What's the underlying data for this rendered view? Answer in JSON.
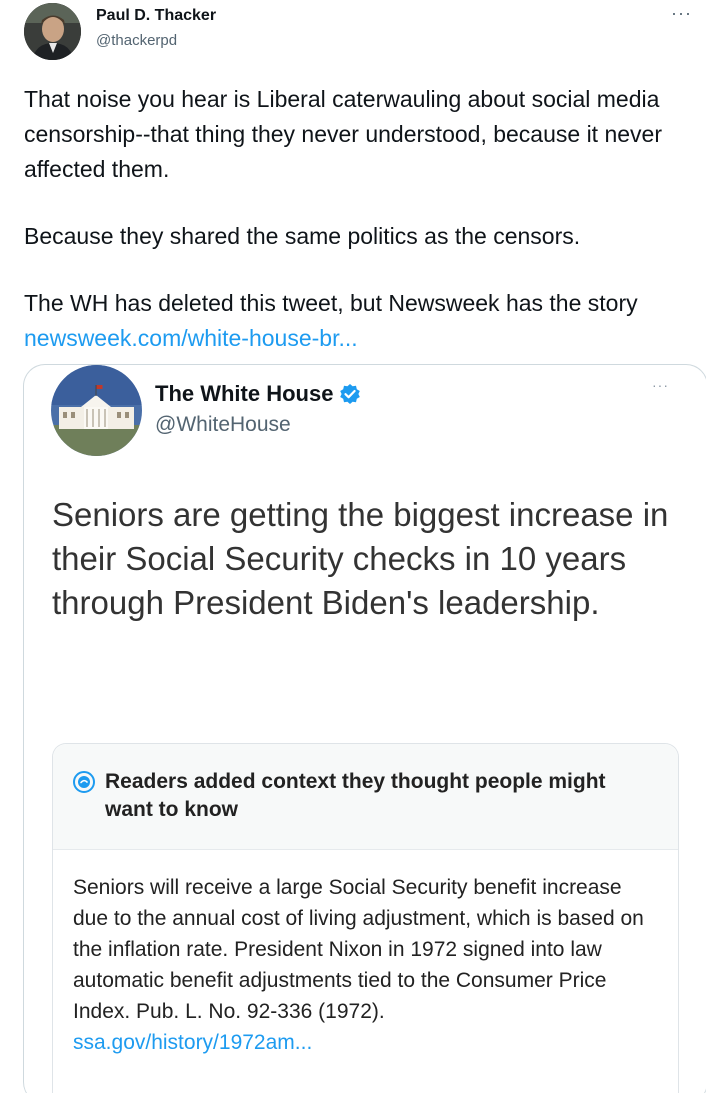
{
  "tweet": {
    "author_name": "Paul D. Thacker",
    "author_handle": "@thackerpd",
    "more_label": "···",
    "paragraph1": "That noise you hear is Liberal caterwauling about social media censorship--that thing they never understood, because it never affected them.",
    "paragraph2": "Because they shared the same politics as the censors.",
    "paragraph3_prefix": "The WH has deleted this tweet, but Newsweek has the story ",
    "link_text": "newsweek.com/white-house-br..."
  },
  "embedded": {
    "author_name": "The White House",
    "author_handle": "@WhiteHouse",
    "more_label": "···",
    "text": "Seniors are getting the biggest increase in their Social Security checks in 10 years through President Biden's leadership.",
    "context": {
      "title": "Readers added context they thought people might want to know",
      "body": "Seniors will receive a large Social Security benefit increase due to the annual cost of living adjustment, which is based on the inflation rate. President Nixon in 1972 signed into law automatic benefit adjustments tied to the Consumer Price Index. Pub. L. No. 92-336 (1972).",
      "link_text": "ssa.gov/history/1972am..."
    }
  },
  "colors": {
    "link": "#1d9bf0",
    "verified": "#1d9bf0",
    "secondary_text": "#536471"
  },
  "icons": [
    "user-avatar",
    "more-icon",
    "white-house-avatar",
    "verified-icon",
    "community-notes-icon"
  ]
}
